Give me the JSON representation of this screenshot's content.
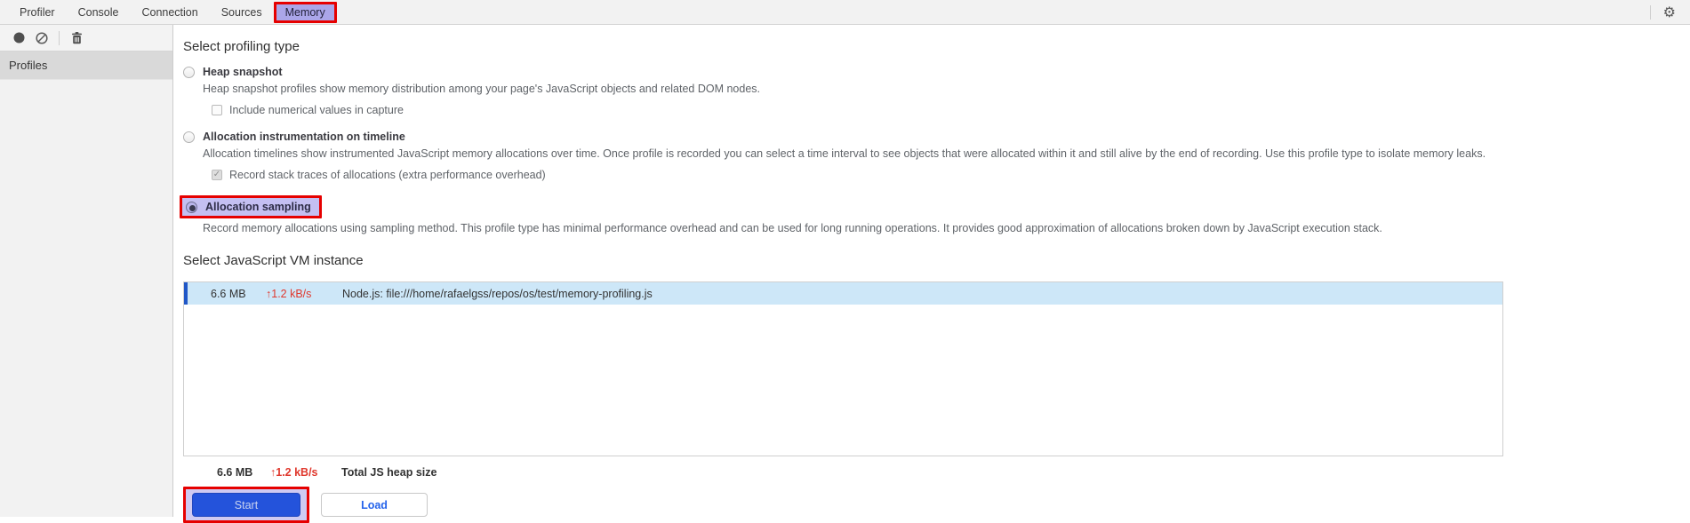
{
  "tabs": {
    "items": [
      {
        "label": "Profiler"
      },
      {
        "label": "Console"
      },
      {
        "label": "Connection"
      },
      {
        "label": "Sources"
      },
      {
        "label": "Memory",
        "selected": true
      }
    ]
  },
  "icons": {
    "gear": "⚙",
    "check": "✓",
    "up_arrow": "↑"
  },
  "sidebar": {
    "selected_item": "Profiles"
  },
  "profiling": {
    "heading": "Select profiling type",
    "options": [
      {
        "label": "Heap snapshot",
        "selected": false,
        "description": "Heap snapshot profiles show memory distribution among your page's JavaScript objects and related DOM nodes.",
        "checkbox_label": "Include numerical values in capture",
        "checkbox_checked": false
      },
      {
        "label": "Allocation instrumentation on timeline",
        "selected": false,
        "description": "Allocation timelines show instrumented JavaScript memory allocations over time. Once profile is recorded you can select a time interval to see objects that were allocated within it and still alive by the end of recording. Use this profile type to isolate memory leaks.",
        "checkbox_label": "Record stack traces of allocations (extra performance overhead)",
        "checkbox_checked": true
      },
      {
        "label": "Allocation sampling",
        "selected": true,
        "highlighted": true,
        "description": "Record memory allocations using sampling method. This profile type has minimal performance overhead and can be used for long running operations. It provides good approximation of allocations broken down by JavaScript execution stack."
      }
    ]
  },
  "vm": {
    "heading": "Select JavaScript VM instance",
    "rows": [
      {
        "size": "6.6 MB",
        "rate": "1.2 kB/s",
        "name": "Node.js: file:///home/rafaelgss/repos/os/test/memory-profiling.js"
      }
    ],
    "total": {
      "size": "6.6 MB",
      "rate": "1.2 kB/s",
      "label": "Total JS heap size"
    }
  },
  "actions": {
    "start_label": "Start",
    "load_label": "Load"
  },
  "colors": {
    "annotation_red": "#e60000",
    "selection_lavender": "#aba6e9",
    "row_highlight_blue": "#cde7f8",
    "row_accent_blue": "#2057c7",
    "start_button_blue": "#2453db",
    "load_text_blue": "#2563eb",
    "rate_red": "#e0382d"
  }
}
